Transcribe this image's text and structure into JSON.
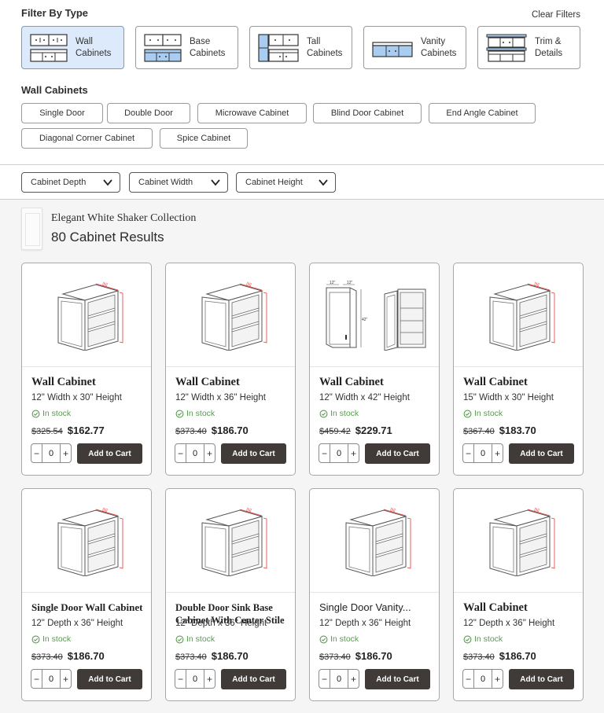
{
  "filter": {
    "title": "Filter By Type",
    "clear_label": "Clear Filters",
    "types": [
      {
        "label": "Wall Cabinets",
        "active": true
      },
      {
        "label": "Base Cabinets",
        "active": false
      },
      {
        "label": "Tall Cabinets",
        "active": false
      },
      {
        "label": "Vanity Cabinets",
        "active": false
      },
      {
        "label": "Trim & Details",
        "active": false
      }
    ]
  },
  "subfilter": {
    "title": "Wall Cabinets",
    "chips": [
      "Single Door",
      "Double Door",
      "Microwave Cabinet",
      "Blind Door Cabinet",
      "End Angle Cabinet",
      "Diagonal Corner Cabinet",
      "Spice Cabinet"
    ]
  },
  "dropdowns": [
    "Cabinet Depth",
    "Cabinet Width",
    "Cabinet Height"
  ],
  "results": {
    "collection": "Elegant White Shaker Collection",
    "count_label": "80 Cabinet Results"
  },
  "colors": {
    "active_type_bg": "#dceafb",
    "icon_blue": "#a9cdf0",
    "in_stock_green": "#5a9a52",
    "add_button": "#403a38",
    "dimension_red": "#e23b3b"
  },
  "products": [
    {
      "name": "Wall Cabinet",
      "dims": "12\" Width x 30\" Height",
      "stock": "In stock",
      "old_price": "$325.54",
      "price": "$162.77",
      "qty": "0",
      "add_label": "Add to Cart",
      "image": "wall-cabinet-diagram"
    },
    {
      "name": "Wall Cabinet",
      "dims": "12\" Width x 36\" Height",
      "stock": "In stock",
      "old_price": "$373.40",
      "price": "$186.70",
      "qty": "0",
      "add_label": "Add to Cart",
      "image": "wall-cabinet-diagram"
    },
    {
      "name": "Wall Cabinet",
      "dims": "12\" Width x 42\" Height",
      "stock": "In stock",
      "old_price": "$459.42",
      "price": "$229.71",
      "qty": "0",
      "add_label": "Add to Cart",
      "image": "wall-cabinet-front-and-open-diagram",
      "labels": [
        "12\"",
        "12\"",
        "42\""
      ]
    },
    {
      "name": "Wall Cabinet",
      "dims": "15\" Width x 30\" Height",
      "stock": "In stock",
      "old_price": "$367.40",
      "price": "$183.70",
      "qty": "0",
      "add_label": "Add to Cart",
      "image": "wall-cabinet-diagram"
    },
    {
      "name": "Single Door Wall Cabinet",
      "dims": "12\" Depth x 36\" Height",
      "stock": "In stock",
      "old_price": "$373.40",
      "price": "$186.70",
      "qty": "0",
      "add_label": "Add to Cart",
      "image": "wall-cabinet-diagram"
    },
    {
      "name": "Double Door Sink Base Cabinet With Center Stile",
      "dims": "12\" Depth x 36\" Height",
      "stock": "In stock",
      "old_price": "$373.40",
      "price": "$186.70",
      "qty": "0",
      "add_label": "Add to Cart",
      "image": "wall-cabinet-diagram"
    },
    {
      "name": "Single Door Vanity...",
      "dims": "12\" Depth x 36\" Height",
      "stock": "In stock",
      "old_price": "$373.40",
      "price": "$186.70",
      "qty": "0",
      "add_label": "Add to Cart",
      "image": "wall-cabinet-diagram"
    },
    {
      "name": "Wall Cabinet",
      "dims": "12\" Depth x 36\" Height",
      "stock": "In stock",
      "old_price": "$373.40",
      "price": "$186.70",
      "qty": "0",
      "add_label": "Add to Cart",
      "image": "wall-cabinet-diagram"
    }
  ]
}
